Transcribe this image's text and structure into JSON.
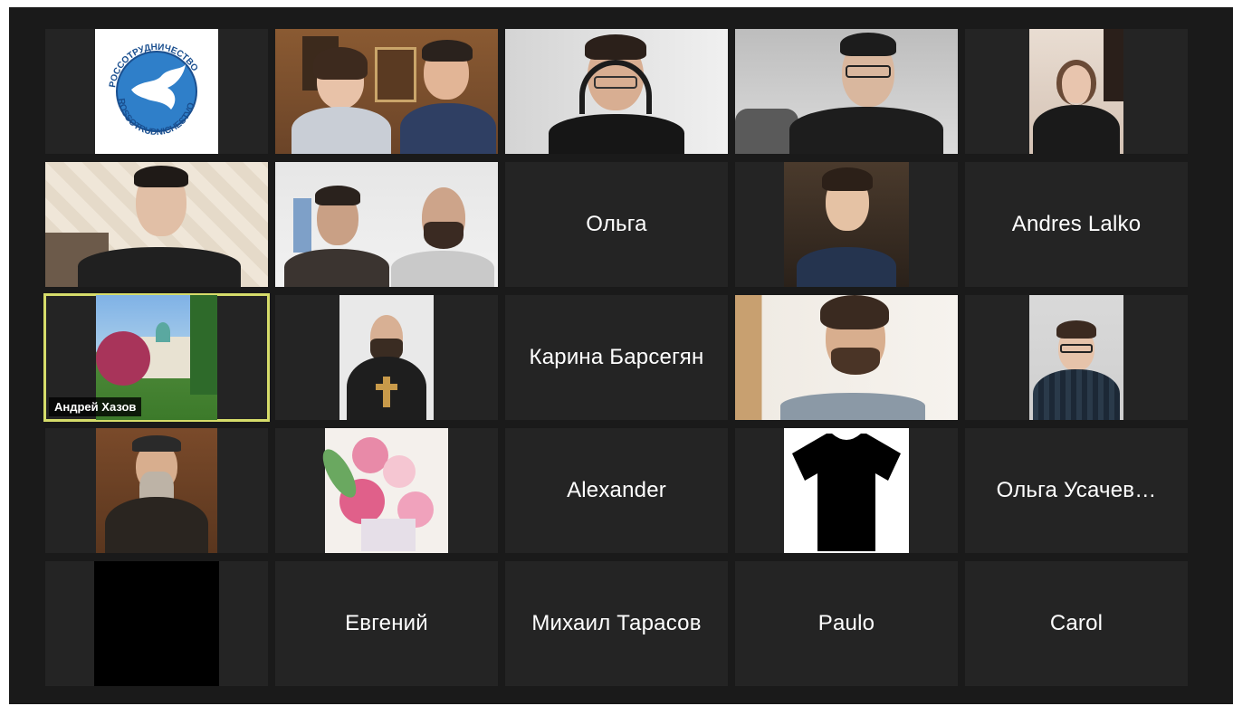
{
  "participants": [
    {
      "name": "",
      "type": "logo",
      "logo_text_top": "РОССОТРУДНИЧЕСТВО",
      "logo_text_bottom": "ROSSOTRUDNICHESTVO"
    },
    {
      "name": "",
      "type": "video"
    },
    {
      "name": "",
      "type": "video"
    },
    {
      "name": "",
      "type": "video"
    },
    {
      "name": "",
      "type": "video"
    },
    {
      "name": "",
      "type": "video"
    },
    {
      "name": "",
      "type": "video"
    },
    {
      "name": "Ольга",
      "type": "name"
    },
    {
      "name": "",
      "type": "video"
    },
    {
      "name": "Andres Lalko",
      "type": "name"
    },
    {
      "name": "Андрей Хазов",
      "type": "avatar",
      "active": true
    },
    {
      "name": "",
      "type": "avatar"
    },
    {
      "name": "Карина Барсегян",
      "type": "name"
    },
    {
      "name": "",
      "type": "video"
    },
    {
      "name": "",
      "type": "video"
    },
    {
      "name": "",
      "type": "avatar"
    },
    {
      "name": "",
      "type": "avatar"
    },
    {
      "name": "Alexander",
      "type": "name"
    },
    {
      "name": "",
      "type": "avatar"
    },
    {
      "name": "Ольга Усачев…",
      "type": "name"
    },
    {
      "name": "",
      "type": "video"
    },
    {
      "name": "Евгений",
      "type": "name"
    },
    {
      "name": "Михаил Тарасов",
      "type": "name"
    },
    {
      "name": "Paulo",
      "type": "name"
    },
    {
      "name": "Carol",
      "type": "name"
    }
  ],
  "colors": {
    "background": "#1a1a1a",
    "tile": "#242424",
    "active_speaker_border": "#d6dc6a",
    "text": "#ffffff"
  }
}
